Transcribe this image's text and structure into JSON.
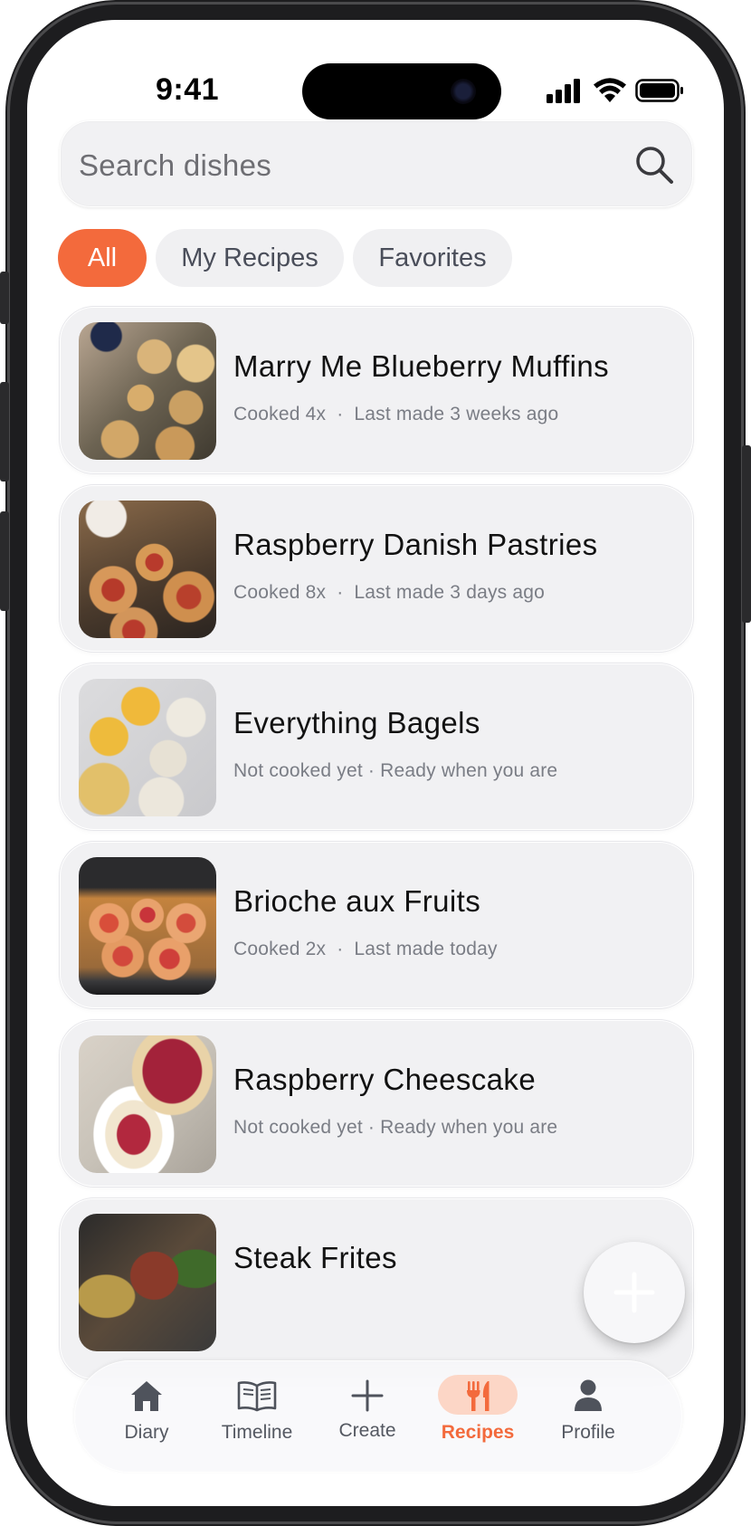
{
  "status_bar": {
    "time": "9:41"
  },
  "search": {
    "placeholder": "Search dishes"
  },
  "filters": [
    {
      "label": "All",
      "active": true
    },
    {
      "label": "My Recipes",
      "active": false
    },
    {
      "label": "Favorites",
      "active": false
    }
  ],
  "recipes": [
    {
      "title": "Marry Me Blueberry Muffins",
      "meta_left": "Cooked 4x",
      "meta_right": "Last made 3 weeks ago",
      "image": "blueberry-muffins"
    },
    {
      "title": "Raspberry Danish Pastries",
      "meta_left": "Cooked 8x",
      "meta_right": "Last made 3 days ago",
      "image": "raspberry-danish"
    },
    {
      "title": "Everything Bagels",
      "meta_left": "Not cooked yet",
      "meta_right": "Ready when you are",
      "image": "bagels"
    },
    {
      "title": "Brioche aux Fruits",
      "meta_left": "Cooked 2x",
      "meta_right": "Last made today",
      "image": "brioche-fruits"
    },
    {
      "title": "Raspberry Cheescake",
      "meta_left": "Not cooked yet",
      "meta_right": "Ready when you are",
      "image": "raspberry-cheesecake"
    },
    {
      "title": "Steak Frites",
      "meta_left": "",
      "meta_right": "",
      "image": "steak-frites"
    }
  ],
  "tabbar": {
    "items": [
      {
        "label": "Diary",
        "icon": "home-icon",
        "active": false
      },
      {
        "label": "Timeline",
        "icon": "book-icon",
        "active": false
      },
      {
        "label": "Create",
        "icon": "plus-icon",
        "active": false
      },
      {
        "label": "Recipes",
        "icon": "fork-knife-icon",
        "active": true
      },
      {
        "label": "Profile",
        "icon": "person-icon",
        "active": false
      }
    ]
  },
  "colors": {
    "accent": "#f36a3c",
    "accent_soft": "#fcd6c6",
    "card_bg": "#f1f1f3",
    "text_muted": "#7a7d85"
  }
}
